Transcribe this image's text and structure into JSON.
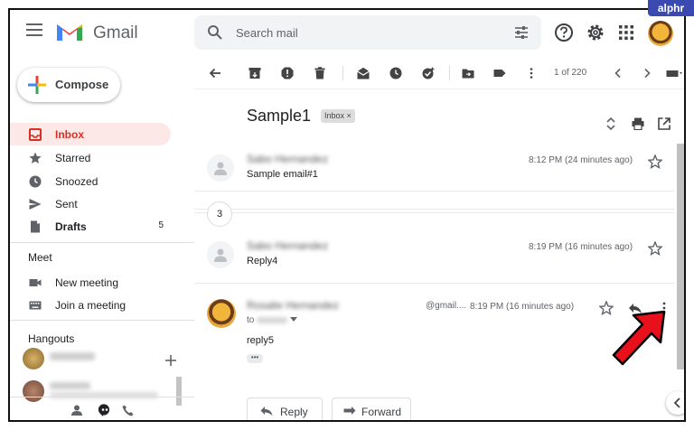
{
  "app": {
    "name": "Gmail",
    "watermark": "alphr"
  },
  "search": {
    "placeholder": "Search mail"
  },
  "compose": {
    "label": "Compose"
  },
  "sidebar": {
    "items": [
      {
        "label": "Inbox",
        "count": ""
      },
      {
        "label": "Starred",
        "count": ""
      },
      {
        "label": "Snoozed",
        "count": ""
      },
      {
        "label": "Sent",
        "count": ""
      },
      {
        "label": "Drafts",
        "count": "5"
      }
    ],
    "meet": {
      "title": "Meet",
      "items": [
        "New meeting",
        "Join a meeting"
      ]
    },
    "hangouts": {
      "title": "Hangouts"
    }
  },
  "toolbar": {
    "pager": "1 of 220"
  },
  "thread": {
    "subject": "Sample1",
    "label_chip": "Inbox ×",
    "collapsed_count": "3",
    "messages": [
      {
        "sender": "Sabo Hernandez",
        "snippet": "Sample email#1",
        "time": "8:12 PM (24 minutes ago)"
      },
      {
        "sender": "Sabo Hernandez",
        "snippet": "Reply4",
        "time": "8:19 PM (16 minutes ago)"
      },
      {
        "sender": "Rosalie Hernandez",
        "email": "@gmail....",
        "to_prefix": "to",
        "time": "8:19 PM (16 minutes ago)",
        "body": "reply5",
        "more": "•••"
      }
    ],
    "reply_label": "Reply",
    "forward_label": "Forward"
  },
  "colors": {
    "inbox_active": "#d93025",
    "inbox_bg": "#fce8e6",
    "arrow": "#e8101a"
  }
}
